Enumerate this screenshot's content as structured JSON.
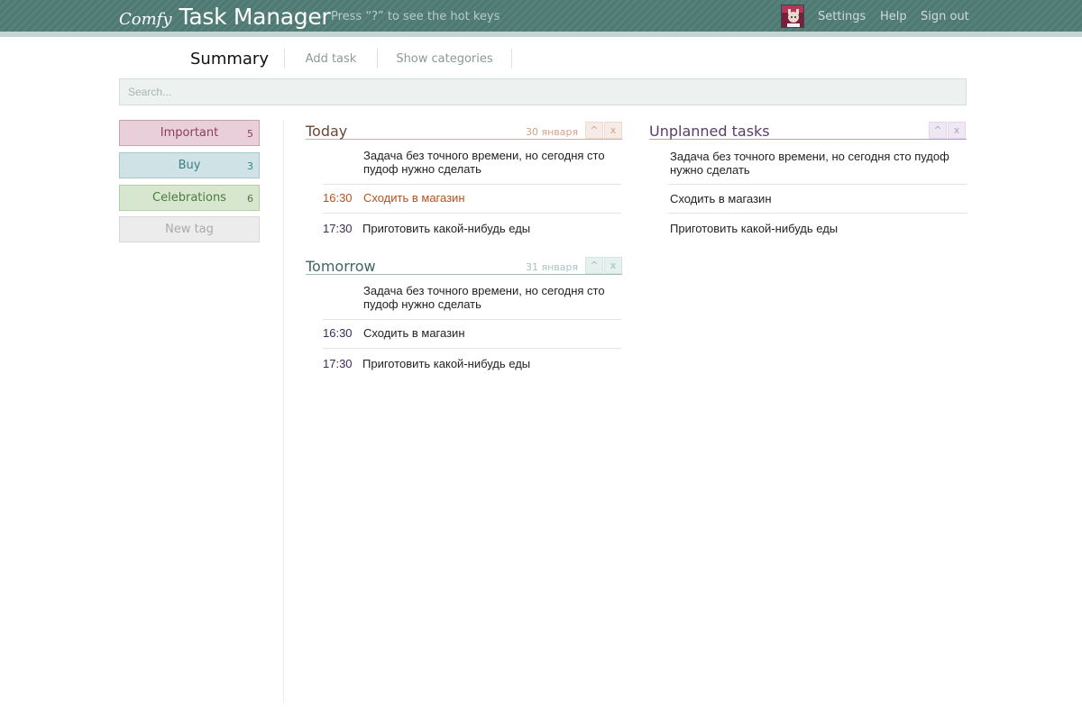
{
  "header": {
    "brand_comfy": "Comfy",
    "brand_title": "Task Manager",
    "hotkeys_hint": "Press “?” to see the hot keys",
    "nav": {
      "settings": "Settings",
      "help": "Help",
      "sign_out": "Sign out"
    },
    "colors": {
      "bar": "#4f7a74",
      "stripe": "#c3d5d2"
    }
  },
  "tabs": {
    "summary": "Summary",
    "add_task": "Add task",
    "show_categories": "Show categories"
  },
  "search": {
    "placeholder": "Search..."
  },
  "sidebar": {
    "tags": [
      {
        "label": "Important",
        "count": "5",
        "color": "#e8cfd9"
      },
      {
        "label": "Buy",
        "count": "3",
        "color": "#cfe2e6"
      },
      {
        "label": "Celebrations",
        "count": "6",
        "color": "#d6e6cf"
      }
    ],
    "new_tag": "New tag"
  },
  "today": {
    "title": "Today",
    "date": "30 января",
    "btn_up": "^",
    "btn_close": "x",
    "tasks": [
      {
        "time": "",
        "text": "Задача без точного времени, но сегодня сто пудоф нужно сделать"
      },
      {
        "time": "16:30",
        "text": "Сходить в магазин"
      },
      {
        "time": "17:30",
        "text": "Приготовить какой-нибудь еды"
      }
    ]
  },
  "tomorrow": {
    "title": "Tomorrow",
    "date": "31 января",
    "btn_up": "^",
    "btn_close": "x",
    "tasks": [
      {
        "time": "",
        "text": "Задача без точного времени, но сегодня сто пудоф нужно сделать"
      },
      {
        "time": "16:30",
        "text": "Сходить в магазин"
      },
      {
        "time": "17:30",
        "text": "Приготовить какой-нибудь еды"
      }
    ]
  },
  "unplanned": {
    "title": "Unplanned tasks",
    "btn_up": "^",
    "btn_close": "x",
    "tasks": [
      {
        "text": "Задача без точного времени, но сегодня сто пудоф нужно сделать"
      },
      {
        "text": "Сходить в магазин"
      },
      {
        "text": "Приготовить какой-нибудь еды"
      }
    ]
  }
}
